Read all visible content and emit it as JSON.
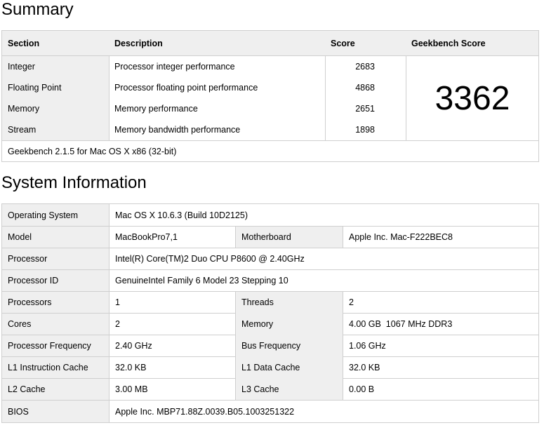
{
  "summary": {
    "heading": "Summary",
    "headers": {
      "section": "Section",
      "description": "Description",
      "score": "Score",
      "geekbench_score": "Geekbench Score"
    },
    "rows": [
      {
        "section": "Integer",
        "description": "Processor integer performance",
        "score": "2683"
      },
      {
        "section": "Floating Point",
        "description": "Processor floating point performance",
        "score": "4868"
      },
      {
        "section": "Memory",
        "description": "Memory performance",
        "score": "2651"
      },
      {
        "section": "Stream",
        "description": "Memory bandwidth performance",
        "score": "1898"
      }
    ],
    "total_score": "3362",
    "footer": "Geekbench 2.1.5 for Mac OS X x86 (32-bit)"
  },
  "sysinfo": {
    "heading": "System Information",
    "os": {
      "label": "Operating System",
      "value": "Mac OS X 10.6.3 (Build 10D2125)"
    },
    "model": {
      "label": "Model",
      "value": "MacBookPro7,1"
    },
    "motherboard": {
      "label": "Motherboard",
      "value": "Apple Inc. Mac-F222BEC8"
    },
    "processor": {
      "label": "Processor",
      "value": "Intel(R) Core(TM)2 Duo CPU P8600 @ 2.40GHz"
    },
    "processor_id": {
      "label": "Processor ID",
      "value": "GenuineIntel Family 6 Model 23 Stepping 10"
    },
    "processors": {
      "label": "Processors",
      "value": "1"
    },
    "threads": {
      "label": "Threads",
      "value": "2"
    },
    "cores": {
      "label": "Cores",
      "value": "2"
    },
    "memory": {
      "label": "Memory",
      "value": "4.00 GB  1067 MHz DDR3"
    },
    "processor_frequency": {
      "label": "Processor Frequency",
      "value": "2.40 GHz"
    },
    "bus_frequency": {
      "label": "Bus Frequency",
      "value": "1.06 GHz"
    },
    "l1_instruction_cache": {
      "label": "L1 Instruction Cache",
      "value": "32.0 KB"
    },
    "l1_data_cache": {
      "label": "L1 Data Cache",
      "value": "32.0 KB"
    },
    "l2_cache": {
      "label": "L2 Cache",
      "value": "3.00 MB"
    },
    "l3_cache": {
      "label": "L3 Cache",
      "value": "0.00 B"
    },
    "bios": {
      "label": "BIOS",
      "value": "Apple Inc. MBP71.88Z.0039.B05.1003251322"
    }
  }
}
